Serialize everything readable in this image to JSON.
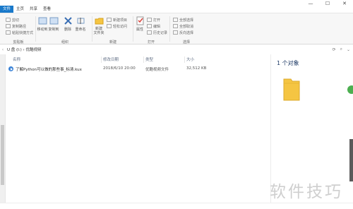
{
  "window": {
    "minimize": "—",
    "maximize": "☐",
    "close": "✕"
  },
  "tabs": [
    "文件",
    "主页",
    "共享",
    "查看"
  ],
  "ribbon": {
    "clipboard": {
      "label": "剪贴板",
      "items": [
        "剪切",
        "复制路径",
        "粘贴快捷方式"
      ]
    },
    "organize": {
      "label": "组织",
      "move_to": "移动到",
      "copy_to": "复制到",
      "delete": "删除",
      "rename": "重命名"
    },
    "new": {
      "label": "新建",
      "new_item": "新建项目",
      "easy_access": "轻松访问",
      "new_folder": "新建\n文件夹"
    },
    "open": {
      "label": "打开",
      "properties": "属性",
      "open": "打开",
      "edit": "编辑",
      "history": "历史记录"
    },
    "select": {
      "label": "选择",
      "select_all": "全部选择",
      "select_none": "全部取消",
      "invert": "反向选择"
    }
  },
  "address": {
    "path": "U 盘 (I:) › 优酷视频"
  },
  "columns": {
    "name": "名称",
    "modified": "修改日期",
    "type": "类型",
    "size": "大小"
  },
  "files": [
    {
      "name": "了解Python可以做的那些事_标清.kux",
      "modified": "2018/6/10 20:00",
      "type": "优酷视频文件",
      "size": "32,512 KB"
    }
  ],
  "preview": {
    "count_text": "1 个对象"
  },
  "watermark": "软件技巧",
  "colors": {
    "accent": "#3a82d6",
    "folder": "#f5c542"
  }
}
